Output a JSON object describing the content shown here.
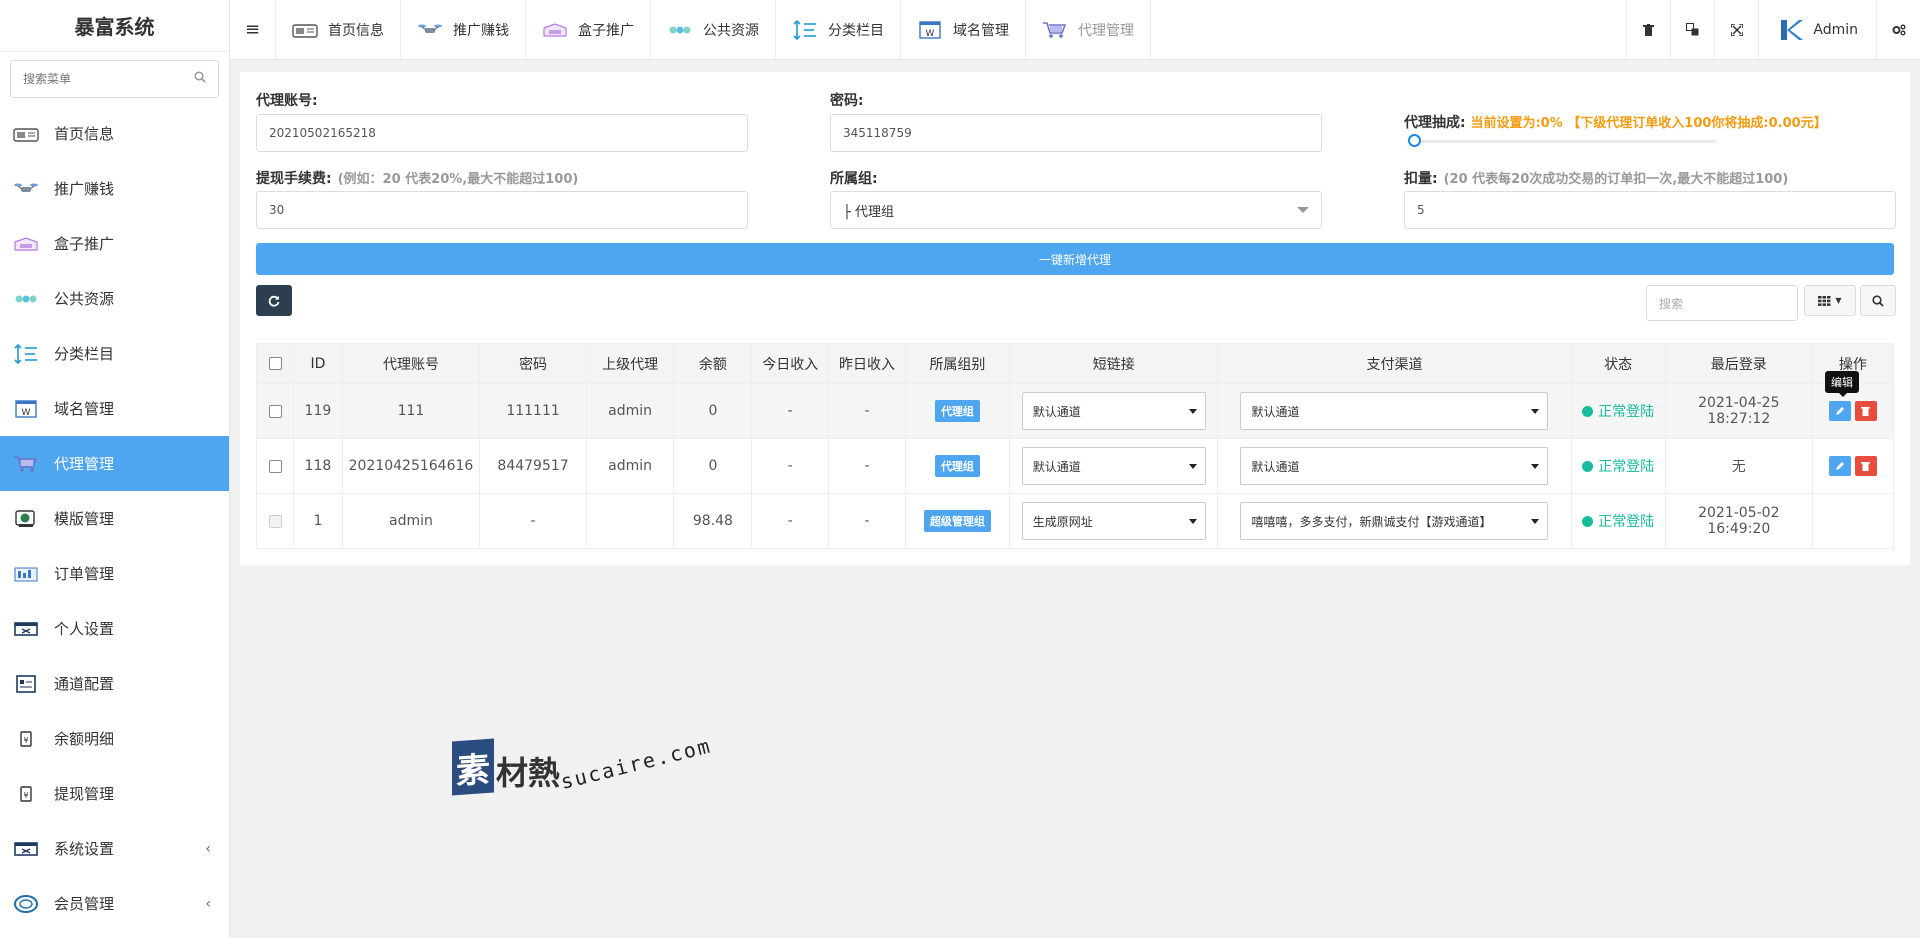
{
  "app": {
    "title": "暴富系统"
  },
  "sidebar": {
    "search_placeholder": "搜索菜单",
    "items": [
      {
        "label": "首页信息",
        "icon": "home-icon"
      },
      {
        "label": "推广赚钱",
        "icon": "drone-icon"
      },
      {
        "label": "盒子推广",
        "icon": "box-icon"
      },
      {
        "label": "公共资源",
        "icon": "share-icon"
      },
      {
        "label": "分类栏目",
        "icon": "sort-icon"
      },
      {
        "label": "域名管理",
        "icon": "domain-icon"
      },
      {
        "label": "代理管理",
        "icon": "cart-icon",
        "active": true
      },
      {
        "label": "模版管理",
        "icon": "template-icon"
      },
      {
        "label": "订单管理",
        "icon": "order-icon"
      },
      {
        "label": "个人设置",
        "icon": "user-settings-icon"
      },
      {
        "label": "通道配置",
        "icon": "channel-icon"
      },
      {
        "label": "余额明细",
        "icon": "balance-icon"
      },
      {
        "label": "提现管理",
        "icon": "withdraw-icon"
      },
      {
        "label": "系统设置",
        "icon": "system-icon",
        "expandable": true
      },
      {
        "label": "会员管理",
        "icon": "member-icon",
        "expandable": true
      }
    ]
  },
  "topbar": {
    "nav": [
      {
        "label": "首页信息"
      },
      {
        "label": "推广赚钱"
      },
      {
        "label": "盒子推广"
      },
      {
        "label": "公共资源"
      },
      {
        "label": "分类栏目"
      },
      {
        "label": "域名管理"
      },
      {
        "label": "代理管理",
        "active": true
      }
    ],
    "user": "Admin"
  },
  "form": {
    "account_label": "代理账号:",
    "account_value": "20210502165218",
    "password_label": "密码:",
    "password_value": "345118759",
    "commission_label": "代理抽成:",
    "commission_note": "当前设置为:0% 【下级代理订单收入100你将抽成:0.00元】",
    "commission_percent": 0,
    "fee_label": "提现手续费:",
    "fee_hint": "(例如：20 代表20%,最大不能超过100)",
    "fee_value": "30",
    "group_label": "所属组:",
    "group_value": "├ 代理组",
    "deduct_label": "扣量:",
    "deduct_hint": "(20 代表每20次成功交易的订单扣一次,最大不能超过100)",
    "deduct_value": "5",
    "add_button": "一键新增代理"
  },
  "toolbar": {
    "search_placeholder": "搜索"
  },
  "table": {
    "headers": [
      "ID",
      "代理账号",
      "密码",
      "上级代理",
      "余额",
      "今日收入",
      "昨日收入",
      "所属组别",
      "短链接",
      "支付渠道",
      "状态",
      "最后登录",
      "操作"
    ],
    "rows": [
      {
        "id": "119",
        "account": "111",
        "password": "111111",
        "parent": "admin",
        "balance": "0",
        "today": "-",
        "yesterday": "-",
        "group": "代理组",
        "short_link": "默认通道",
        "pay_channel": "默认通道",
        "status": "正常登陆",
        "last_login": "2021-04-25 18:27:12",
        "actions": true
      },
      {
        "id": "118",
        "account": "20210425164616",
        "password": "84479517",
        "parent": "admin",
        "balance": "0",
        "today": "-",
        "yesterday": "-",
        "group": "代理组",
        "short_link": "默认通道",
        "pay_channel": "默认通道",
        "status": "正常登陆",
        "last_login": "无",
        "actions": true
      },
      {
        "id": "1",
        "account": "admin",
        "password": "-",
        "parent": "",
        "balance": "98.48",
        "today": "-",
        "yesterday": "-",
        "group": "超级管理组",
        "short_link": "生成原网址",
        "pay_channel": "嘻嘻嘻，多多支付，新鼎诚支付【游戏通道】",
        "status": "正常登陆",
        "last_login": "2021-05-02 16:49:20",
        "actions": false
      }
    ],
    "tooltip": "编辑"
  },
  "watermark": {
    "text": "素材熱",
    "url": "sucaire.com"
  },
  "colors": {
    "accent": "#4da6ef",
    "success": "#18bc9c",
    "danger": "#e74c3c",
    "warning": "#f39c12",
    "dark": "#2c3e50"
  }
}
